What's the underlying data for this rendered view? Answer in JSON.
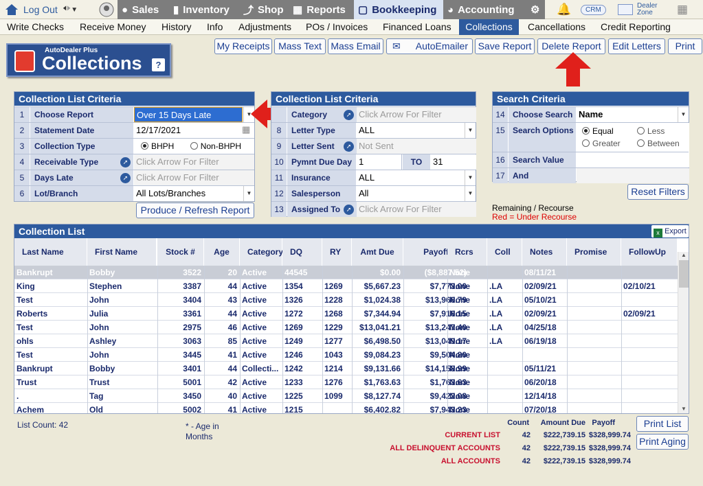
{
  "topbar": {
    "logout": "Log Out",
    "tabs": [
      "Sales",
      "Inventory",
      "Shop",
      "Reports",
      "Bookkeeping",
      "Accounting"
    ],
    "crm": "CRM",
    "dealer_zone": "Dealer Zone"
  },
  "subnav": [
    "Write Checks",
    "Receive Money",
    "History",
    "Info",
    "Adjustments",
    "POs / Invoices",
    "Financed Loans",
    "Collections",
    "Cancellations",
    "Credit Reporting"
  ],
  "logo": {
    "small": "AutoDealer Plus",
    "big": "Collections",
    "help": "?"
  },
  "actions": [
    "My Receipts",
    "Mass Text",
    "Mass Email",
    "AutoEmailer",
    "Save Report",
    "Delete Report",
    "Edit Letters",
    "Print"
  ],
  "criteria1": {
    "title": "Collection List Criteria",
    "rows": [
      {
        "n": "1",
        "label": "Choose Report",
        "value": "Over 15 Days Late"
      },
      {
        "n": "2",
        "label": "Statement Date",
        "value": "12/17/2021"
      },
      {
        "n": "3",
        "label": "Collection Type",
        "opt1": "BHPH",
        "opt2": "Non-BHPH"
      },
      {
        "n": "4",
        "label": "Receivable Type",
        "value": "Click Arrow For Filter"
      },
      {
        "n": "5",
        "label": "Days Late",
        "value": "Click Arrow For Filter"
      },
      {
        "n": "6",
        "label": "Lot/Branch",
        "value": "All Lots/Branches"
      }
    ],
    "produce": "Produce / Refresh Report"
  },
  "criteria2": {
    "title": "Collection List Criteria",
    "rows": [
      {
        "n": "",
        "label": "Category",
        "value": "Click Arrow For Filter"
      },
      {
        "n": "8",
        "label": "Letter Type",
        "value": "ALL"
      },
      {
        "n": "9",
        "label": "Letter Sent",
        "value": "Not Sent"
      },
      {
        "n": "10",
        "label": "Pymnt Due Day",
        "value": "1",
        "to": "TO",
        "value2": "31"
      },
      {
        "n": "11",
        "label": "Insurance",
        "value": "ALL"
      },
      {
        "n": "12",
        "label": "Salesperson",
        "value": "All"
      },
      {
        "n": "13",
        "label": "Assigned To",
        "value": "Click Arrow For Filter"
      }
    ]
  },
  "search": {
    "title": "Search Criteria",
    "rows": [
      {
        "n": "14",
        "label": "Choose Search",
        "value": "Name"
      },
      {
        "n": "15",
        "label": "Search Options",
        "opts": [
          "Equal",
          "Less",
          "Greater",
          "Between"
        ]
      },
      {
        "n": "16",
        "label": "Search Value",
        "value": ""
      },
      {
        "n": "17",
        "label": "And",
        "value": ""
      }
    ],
    "reset": "Reset Filters",
    "note1": "Remaining / Recourse",
    "note2": "Red = Under Recourse"
  },
  "list": {
    "title": "Collection List",
    "export": "Export",
    "columns": [
      "Last Name",
      "First Name",
      "Stock #",
      "Age",
      "Category",
      "DQ",
      "RY",
      "Amt Due",
      "Payoff",
      "Rcrs",
      "Coll",
      "Notes",
      "Promise",
      "FollowUp"
    ],
    "rows": [
      [
        "Bankrupt",
        "Bobby",
        "3522",
        "20",
        "Active",
        "44545",
        "",
        "$0.00",
        "($8,887.52)",
        "None",
        "",
        "08/11/21",
        "",
        ""
      ],
      [
        "King",
        "Stephen",
        "3387",
        "44",
        "Active",
        "1354",
        "1269",
        "$5,667.23",
        "$7,773.00",
        "None",
        ".LA",
        "02/09/21",
        "",
        "02/10/21"
      ],
      [
        "Test",
        "John",
        "3404",
        "43",
        "Active",
        "1326",
        "1228",
        "$1,024.38",
        "$13,966.79",
        "None",
        ".LA",
        "05/10/21",
        "",
        ""
      ],
      [
        "Roberts",
        "Julia",
        "3361",
        "44",
        "Active",
        "1272",
        "1268",
        "$7,344.94",
        "$7,916.15",
        "None",
        ".LA",
        "02/09/21",
        "",
        "02/09/21"
      ],
      [
        "Test",
        "John",
        "2975",
        "46",
        "Active",
        "1269",
        "1229",
        "$13,041.21",
        "$13,247.40",
        "None",
        ".LA",
        "04/25/18",
        "",
        ""
      ],
      [
        "ohls",
        "Ashley",
        "3063",
        "85",
        "Active",
        "1249",
        "1277",
        "$6,498.50",
        "$13,049.17",
        "None",
        ".LA",
        "06/19/18",
        "",
        ""
      ],
      [
        "Test",
        "John",
        "3445",
        "41",
        "Active",
        "1246",
        "1043",
        "$9,084.23",
        "$9,504.80",
        "None",
        "",
        "",
        "",
        ""
      ],
      [
        "Bankrupt",
        "Bobby",
        "3401",
        "44",
        "Collecti...",
        "1242",
        "1214",
        "$9,131.66",
        "$14,158.99",
        "None",
        "",
        "05/11/21",
        "",
        ""
      ],
      [
        "Trust",
        "Trust",
        "5001",
        "42",
        "Active",
        "1233",
        "1276",
        "$1,763.63",
        "$1,763.63",
        "None",
        "",
        "06/20/18",
        "",
        ""
      ],
      [
        ".",
        "Tag",
        "3450",
        "40",
        "Active",
        "1225",
        "1099",
        "$8,127.74",
        "$9,422.08",
        "None",
        "",
        "12/14/18",
        "",
        ""
      ],
      [
        "Achem",
        "Old",
        "5002",
        "41",
        "Active",
        "1215",
        "",
        "$6,402.82",
        "$7,943.23",
        "None",
        "",
        "07/20/18",
        "",
        ""
      ]
    ]
  },
  "footer": {
    "list_count_label": "List Count:",
    "list_count": "42",
    "age_note": "* - Age in Months",
    "headers": [
      "Count",
      "Amount Due",
      "Payoff"
    ],
    "totals": [
      {
        "label": "CURRENT LIST",
        "count": "42",
        "amount": "$222,739.15",
        "payoff": "$328,999.74"
      },
      {
        "label": "ALL DELINQUENT ACCOUNTS",
        "count": "42",
        "amount": "$222,739.15",
        "payoff": "$328,999.74"
      },
      {
        "label": "ALL ACCOUNTS",
        "count": "42",
        "amount": "$222,739.15",
        "payoff": "$328,999.74"
      }
    ],
    "print_list": "Print List",
    "print_aging": "Print Aging"
  }
}
